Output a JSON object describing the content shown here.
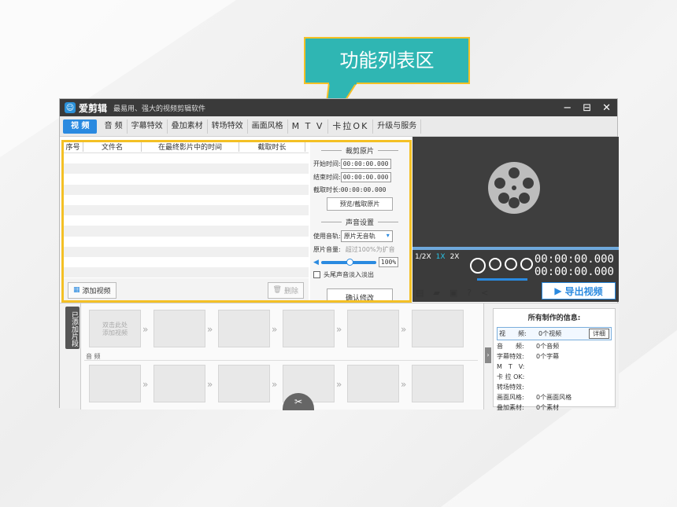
{
  "callout": {
    "label": "功能列表区"
  },
  "window": {
    "app_name": "爱剪辑",
    "slogan": "最易用、强大的视频剪辑软件",
    "controls": [
      "−",
      "⊟",
      "✕"
    ]
  },
  "tabs": [
    {
      "label": "视 频"
    },
    {
      "label": "音 频"
    },
    {
      "label": "字幕特效"
    },
    {
      "label": "叠加素材"
    },
    {
      "label": "转场特效"
    },
    {
      "label": "画面风格"
    },
    {
      "label": "M T V"
    },
    {
      "label": "卡拉OK"
    },
    {
      "label": "升级与服务"
    }
  ],
  "list": {
    "columns": [
      "序号",
      "文件名",
      "在最终影片中的时间",
      "截取时长"
    ],
    "add_button": "添加视频",
    "delete_button": "删除"
  },
  "crop": {
    "title": "裁剪原片",
    "start_label": "开始时间:",
    "start_value": "00:00:00.000",
    "end_label": "结束时间:",
    "end_value": "00:00:00.000",
    "duration_label": "截取时长:",
    "duration_value": "00:00:00.000",
    "preview_button": "预览/截取原片",
    "audio_title": "声音设置",
    "track_label": "使用音轨:",
    "track_value": "原片无音轨",
    "volume_label": "原片音量:",
    "volume_hint": "超过100%为扩音",
    "volume_value": "100%",
    "fade_label": "头尾声音淡入淡出",
    "confirm_button": "确认修改"
  },
  "player": {
    "speeds": [
      "1/2X",
      "1X",
      "2X"
    ],
    "selected_speed": "1X",
    "time_current": "00:00:00.000",
    "time_total": "00:00:00.000",
    "export_button": "导出视频"
  },
  "timeline": {
    "side_label": "已添加片段",
    "hint": "双击此处\n添加视频",
    "audio_label": "音 频"
  },
  "info": {
    "title": "所有制作的信息:",
    "detail_button": "详细",
    "rows": [
      {
        "key": "视　　频:",
        "value": "0个视频"
      },
      {
        "key": "音　　频:",
        "value": "0个音频"
      },
      {
        "key": "字幕特效:",
        "value": "0个字幕"
      },
      {
        "key": "M　T　V:",
        "value": ""
      },
      {
        "key": "卡 拉 OK:",
        "value": ""
      },
      {
        "key": "转场特效:",
        "value": ""
      },
      {
        "key": "画面风格:",
        "value": "0个画面风格"
      },
      {
        "key": "叠加素材:",
        "value": "0个素材"
      }
    ]
  },
  "colors": {
    "accent": "#2a8ae0",
    "callout": "#2fb6b3",
    "highlight": "#f4c025"
  }
}
